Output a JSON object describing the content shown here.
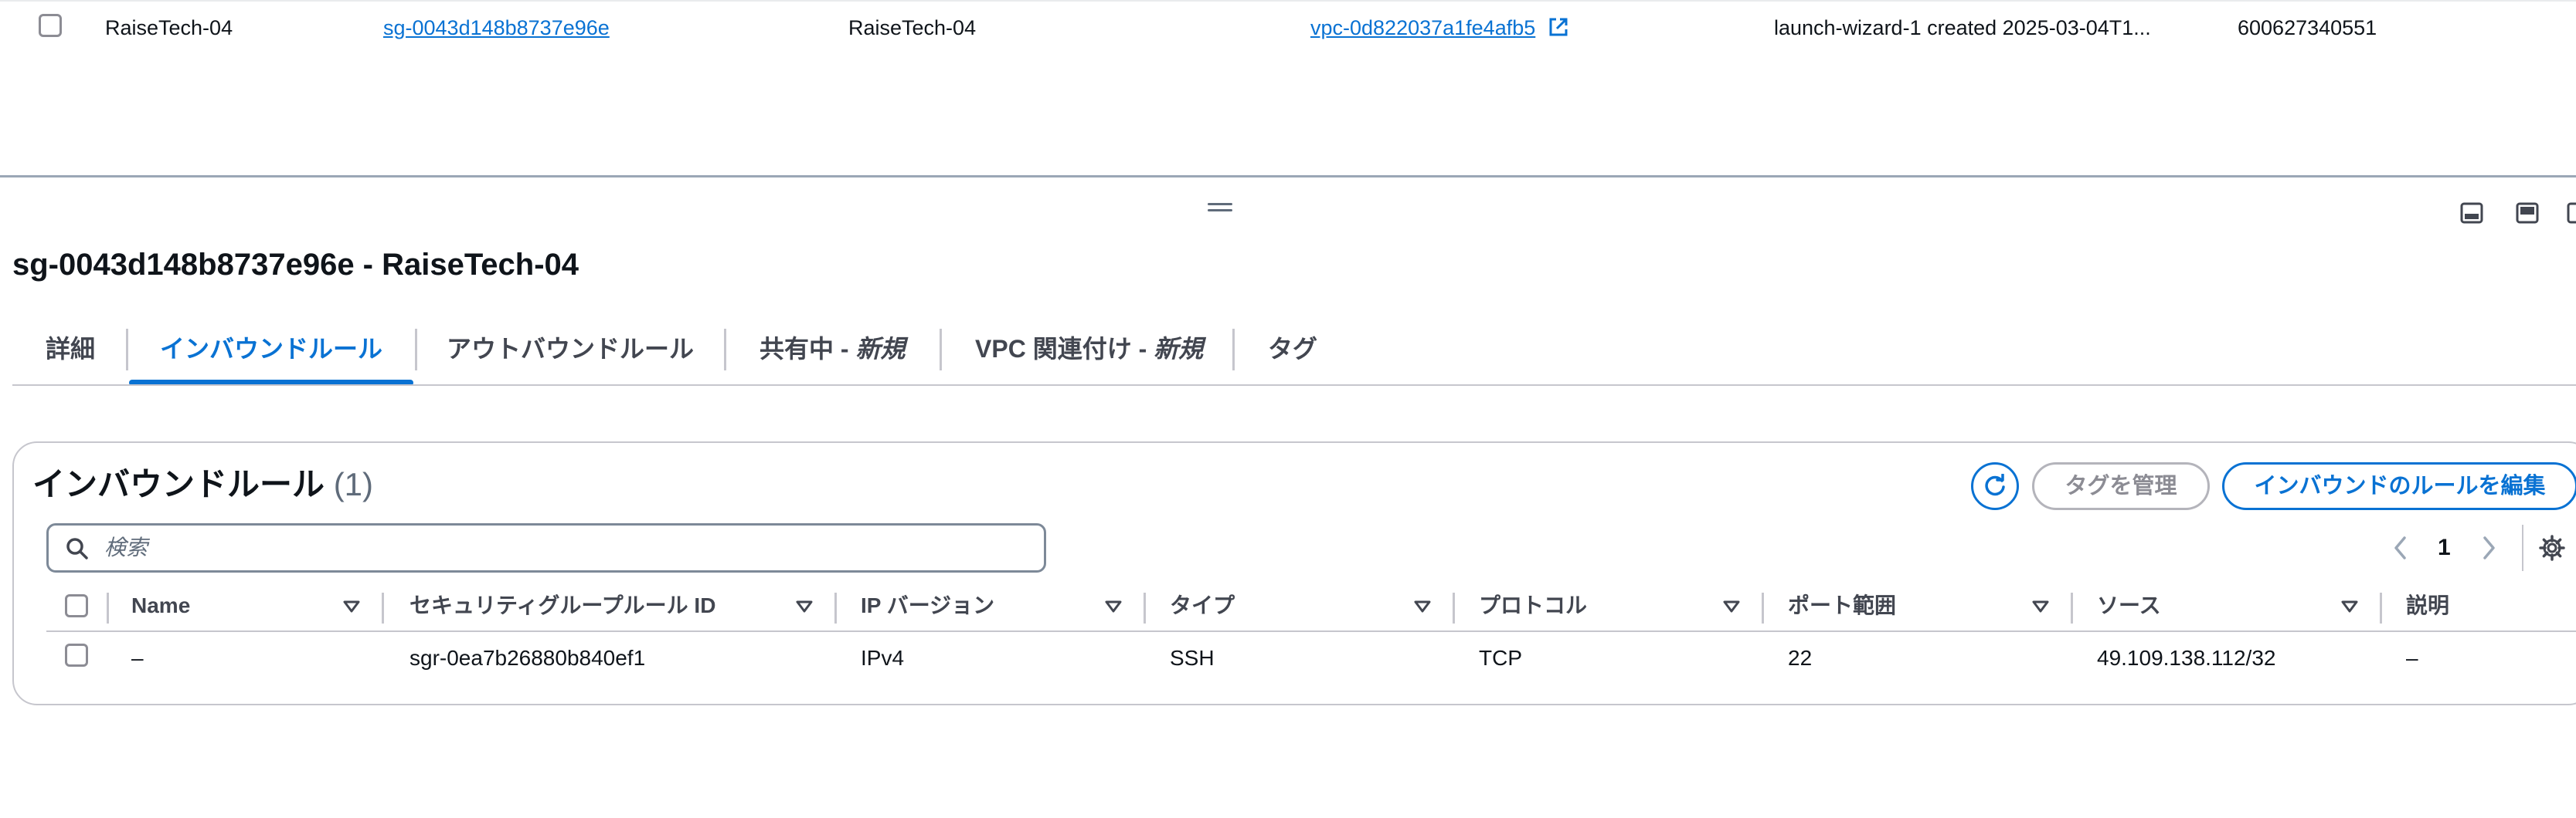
{
  "list": {
    "row": {
      "name": "RaiseTech-04",
      "group_id": "sg-0043d148b8737e96e",
      "group_name": "RaiseTech-04",
      "vpc_id": "vpc-0d822037a1fe4afb5",
      "description": "launch-wizard-1 created 2025-03-04T1...",
      "owner": "600627340551"
    }
  },
  "details": {
    "title": "sg-0043d148b8737e96e - RaiseTech-04",
    "tabs": {
      "details": "詳細",
      "inbound": "インバウンドルール",
      "outbound": "アウトバウンドルール",
      "sharing": "共有中 - ",
      "sharing_new": "新規",
      "vpc_assoc": "VPC 関連付け - ",
      "vpc_assoc_new": "新規",
      "tags": "タグ"
    },
    "active_tab": "inbound"
  },
  "rules": {
    "title": "インバウンドルール",
    "count": "(1)",
    "buttons": {
      "manage_tags": "タグを管理",
      "edit_rules": "インバウンドのルールを編集"
    },
    "search": {
      "placeholder": "検索",
      "value": ""
    },
    "pagination": {
      "page": "1"
    },
    "columns": {
      "name": "Name",
      "rule_id": "セキュリティグループルール ID",
      "ip_version": "IP バージョン",
      "type": "タイプ",
      "protocol": "プロトコル",
      "port_range": "ポート範囲",
      "source": "ソース",
      "description": "説明"
    },
    "rows": [
      {
        "name": "–",
        "rule_id": "sgr-0ea7b26880b840ef1",
        "ip_version": "IPv4",
        "type": "SSH",
        "protocol": "TCP",
        "port_range": "22",
        "source": "49.109.138.112/32",
        "description": "–"
      }
    ]
  },
  "colors": {
    "link": "#0972d3",
    "text": "#0f141a",
    "muted": "#5f6b7a",
    "border": "#c6c6cd",
    "disabled": "#8c8c94"
  },
  "icons": [
    "external-link-icon",
    "drag-handle-icon",
    "panel-bottom-icon",
    "panel-side-icon",
    "refresh-icon",
    "search-icon",
    "chevron-left-icon",
    "chevron-right-icon",
    "settings-gear-icon",
    "sort-caret-icon"
  ]
}
